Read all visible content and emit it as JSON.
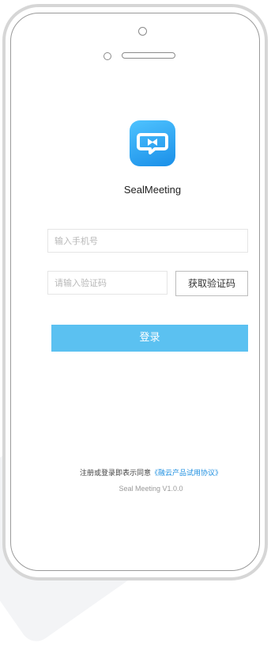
{
  "app": {
    "name": "SealMeeting"
  },
  "login_form": {
    "phone_placeholder": "输入手机号",
    "code_placeholder": "请输入验证码",
    "get_code_label": "获取验证码",
    "login_label": "登录"
  },
  "footer": {
    "agreement_prefix": "注册或登录即表示同意",
    "agreement_link": "《融云产品试用协议》",
    "version": "Seal Meeting V1.0.0"
  },
  "colors": {
    "accent": "#5bc1f1",
    "link": "#1e8fe0",
    "icon_gradient_top": "#4fc3ff",
    "icon_gradient_bottom": "#1a8fe8"
  },
  "icons": {
    "app_icon": "meeting-chat-bubble-icon"
  }
}
